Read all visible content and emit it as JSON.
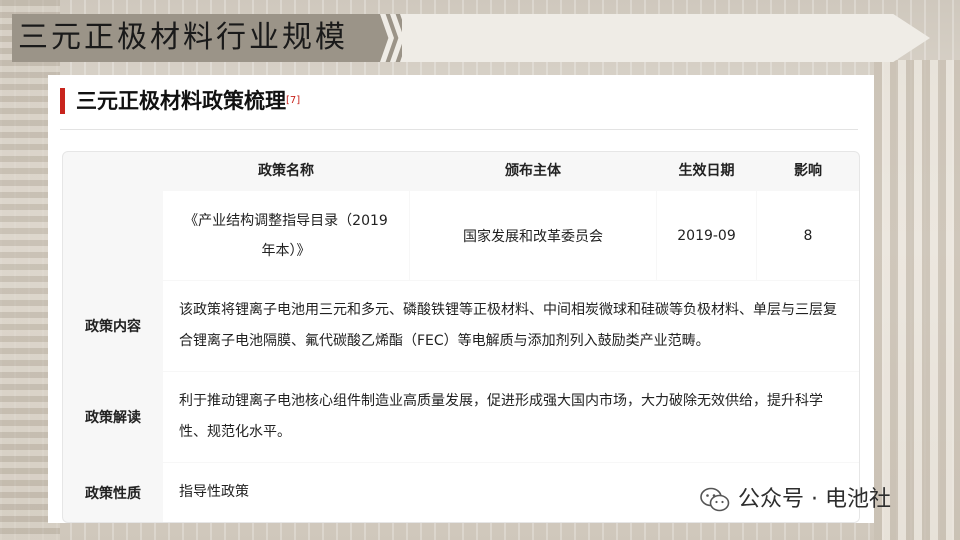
{
  "page": {
    "title": "三元正极材料行业规模"
  },
  "card": {
    "title": "三元正极材料政策梳理",
    "citation": "[7]"
  },
  "table": {
    "headers": {
      "name": "政策名称",
      "issuer": "颁布主体",
      "date": "生效日期",
      "impact": "影响"
    },
    "policy": {
      "name": "《产业结构调整指导目录（2019年本）》",
      "issuer": "国家发展和改革委员会",
      "date": "2019-09",
      "impact": "8"
    },
    "rows": [
      {
        "label": "政策内容",
        "text": "该政策将锂离子电池用三元和多元、磷酸铁锂等正极材料、中间相炭微球和硅碳等负极材料、单层与三层复合锂离子电池隔膜、氟代碳酸乙烯酯（FEC）等电解质与添加剂列入鼓励类产业范畴。"
      },
      {
        "label": "政策解读",
        "text": "利于推动锂离子电池核心组件制造业高质量发展，促进形成强大国内市场，大力破除无效供给，提升科学性、规范化水平。"
      },
      {
        "label": "政策性质",
        "text": "指导性政策"
      }
    ]
  },
  "watermark": {
    "text": "公众号 · 电池社",
    "icon": "wechat-icon"
  },
  "colors": {
    "accent": "#c8241d",
    "banner_dark": "#9b9488",
    "banner_light": "#efece6"
  }
}
